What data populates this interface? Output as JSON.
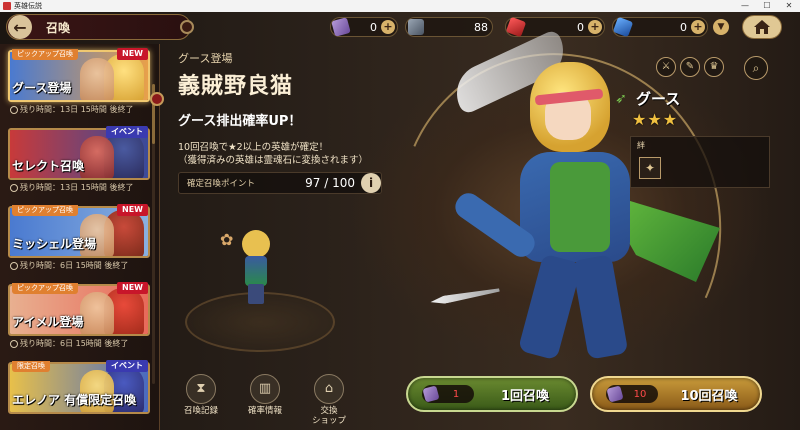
{
  "window": {
    "title": "英雄伝説",
    "minimize": "—",
    "maximize": "☐",
    "close": "✕"
  },
  "topbar": {
    "page_title": "召喚",
    "currencies": [
      {
        "icon": "summon-ticket-icon",
        "value": "0"
      },
      {
        "icon": "stone-icon",
        "value": "88"
      },
      {
        "icon": "red-crystal-icon",
        "value": "0"
      },
      {
        "icon": "blue-crystal-icon",
        "value": "0"
      }
    ]
  },
  "banners": [
    {
      "tag": "ピックアップ召喚",
      "badge": "NEW",
      "name": "グース登場",
      "remaining": "残り時間：13日 15時間 後終了",
      "active": true,
      "colors": [
        "#e8a04a",
        "#4a7ad0"
      ]
    },
    {
      "tag": "",
      "badge": "イベント",
      "name": "セレクト召喚",
      "remaining": "残り時間：13日 15時間 後終了",
      "active": false,
      "colors": [
        "#c83a3a",
        "#3a4a9a"
      ]
    },
    {
      "tag": "ピックアップ召喚",
      "badge": "NEW",
      "name": "ミッシェル登場",
      "remaining": "残り時間：6日 15時間 後終了",
      "active": false,
      "colors": [
        "#4a7ad0",
        "#c84a3a"
      ]
    },
    {
      "tag": "ピックアップ召喚",
      "badge": "NEW",
      "name": "アイメル登場",
      "remaining": "残り時間：6日 15時間 後終了",
      "active": false,
      "colors": [
        "#e86a5a",
        "#c83a3a"
      ]
    },
    {
      "tag": "限定召喚",
      "badge": "イベント",
      "name": "エレノア 有償限定召喚",
      "remaining": "",
      "active": false,
      "colors": [
        "#e8c04a",
        "#4a6ac0"
      ]
    }
  ],
  "main": {
    "subtitle": "グース登場",
    "title": "義賊野良猫",
    "rateup": "グース排出確率UP！",
    "desc_line1": "10回召喚で★2以上の英雄が確定！",
    "desc_line2": "（獲得済みの英雄は霊魂石に変換されます）",
    "points_label": "確定召喚ポイント",
    "points_value": "97 / 100",
    "points_info": "i"
  },
  "character": {
    "name": "グース",
    "stars": "★★★",
    "bond_label": "絆"
  },
  "bottom_menu": [
    {
      "icon": "history-icon",
      "label": "召喚記録"
    },
    {
      "icon": "chart-icon",
      "label": "確率情報"
    },
    {
      "icon": "shop-icon",
      "label": "交換\nショップ"
    }
  ],
  "summon_single": {
    "cost": "1",
    "label": "1回召喚"
  },
  "summon_multi": {
    "cost": "10",
    "label": "10回召喚"
  },
  "colors": {
    "accent_gold": "#e0c894",
    "badge_red": "#c8162a",
    "cost_red": "#ff4a4a"
  }
}
